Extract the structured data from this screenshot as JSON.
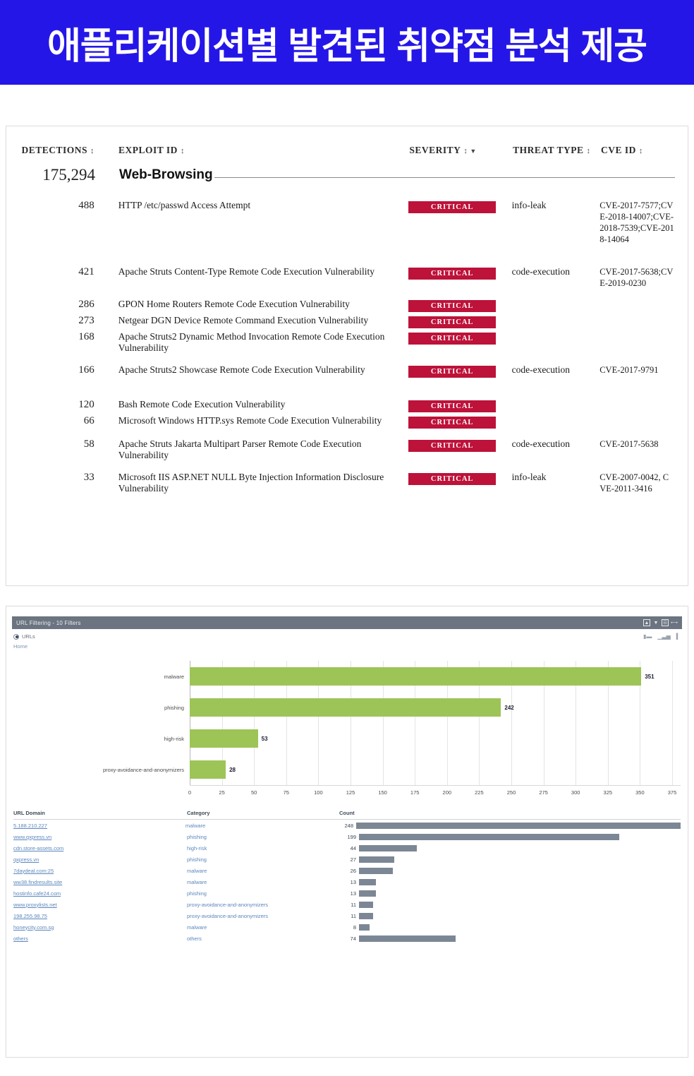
{
  "banner": {
    "title": "애플리케이션별 발견된 취약점 분석 제공",
    "color": "#2516e8"
  },
  "exploit_table": {
    "columns": [
      {
        "label": "DETECTIONS",
        "sort": "↕"
      },
      {
        "label": "EXPLOIT ID",
        "sort": "↕"
      },
      {
        "label": "SEVERITY",
        "sort": "↕",
        "sort_dir": "▼"
      },
      {
        "label": "THREAT TYPE",
        "sort": "↕"
      },
      {
        "label": "CVE ID",
        "sort": "↕"
      }
    ],
    "group": {
      "count": "175,294",
      "name": "Web-Browsing"
    },
    "rows": [
      {
        "detections": "488",
        "exploit_id": "HTTP /etc/passwd Access Attempt",
        "severity": "CRITICAL",
        "threat_type": "info-leak",
        "cve_id": "CVE-2017-7577;CVE-2018-14007;CVE-2018-7539;CVE-2018-14064"
      },
      {
        "detections": "421",
        "exploit_id": "Apache Struts Content-Type Remote Code Execution Vulnerability",
        "severity": "CRITICAL",
        "threat_type": "code-execution",
        "cve_id": "CVE-2017-5638;CVE-2019-0230"
      },
      {
        "detections": "286",
        "exploit_id": "GPON Home Routers Remote Code Execution Vulnerability",
        "severity": "CRITICAL",
        "threat_type": "",
        "cve_id": ""
      },
      {
        "detections": "273",
        "exploit_id": "Netgear DGN Device Remote Command Execution Vulnerability",
        "severity": "CRITICAL",
        "threat_type": "",
        "cve_id": ""
      },
      {
        "detections": "168",
        "exploit_id": "Apache Struts2 Dynamic Method Invocation Remote Code Execution Vulnerability",
        "severity": "CRITICAL",
        "threat_type": "",
        "cve_id": ""
      },
      {
        "detections": "166",
        "exploit_id": "Apache Struts2 Showcase Remote Code Execution Vulnerability",
        "severity": "CRITICAL",
        "threat_type": "code-execution",
        "cve_id": "CVE-2017-9791"
      },
      {
        "detections": "120",
        "exploit_id": "Bash Remote Code Execution Vulnerability",
        "severity": "CRITICAL",
        "threat_type": "",
        "cve_id": ""
      },
      {
        "detections": "66",
        "exploit_id": "Microsoft Windows HTTP.sys Remote Code Execution Vulnerability",
        "severity": "CRITICAL",
        "threat_type": "",
        "cve_id": ""
      },
      {
        "detections": "58",
        "exploit_id": "Apache Struts Jakarta Multipart Parser Remote Code Execution Vulnerability",
        "severity": "CRITICAL",
        "threat_type": "code-execution",
        "cve_id": "CVE-2017-5638"
      },
      {
        "detections": "33",
        "exploit_id": "Microsoft IIS ASP.NET NULL Byte Injection Information Disclosure Vulnerability",
        "severity": "CRITICAL",
        "threat_type": "info-leak",
        "cve_id": "CVE-2007-0042, CVE-2011-3416"
      }
    ],
    "badge_color": "#bd1239"
  },
  "url_panel": {
    "title": "URL Filtering  - 10 Filters",
    "titlebar_icons": [
      "image-icon",
      "filter-icon",
      "list-icon",
      "expand-icon"
    ],
    "subbar_icons": [
      "sort-icon",
      "bar-chart-icon",
      "column-chart-icon"
    ],
    "radio_label": "URLs",
    "breadcrumb": "Home"
  },
  "chart_data": {
    "type": "bar",
    "orientation": "horizontal",
    "title": "",
    "xlabel": "",
    "ylabel": "",
    "categories": [
      "malware",
      "phishing",
      "high-risk",
      "proxy-avoidance-and-anonymizers"
    ],
    "values": [
      351,
      242,
      53,
      28
    ],
    "xlim": [
      0,
      375
    ],
    "xticks": [
      0,
      25,
      50,
      75,
      100,
      125,
      150,
      175,
      200,
      225,
      250,
      275,
      300,
      325,
      350,
      375
    ],
    "grid": true,
    "legend": "none",
    "bar_color": "#9dc457"
  },
  "domain_table": {
    "columns": [
      "URL Domain",
      "Category",
      "Count"
    ],
    "max_count": 248,
    "bar_color": "#7c8795",
    "rows": [
      {
        "domain": "5.188.210.227",
        "category": "malware",
        "count": 248
      },
      {
        "domain": "www.qxpress.vn",
        "category": "phishing",
        "count": 199
      },
      {
        "domain": "cdn.store-assets.com",
        "category": "high-risk",
        "count": 44
      },
      {
        "domain": "qxpress.vn",
        "category": "phishing",
        "count": 27
      },
      {
        "domain": "7daydeal.com:25",
        "category": "malware",
        "count": 26
      },
      {
        "domain": "ww38.findresults.site",
        "category": "malware",
        "count": 13
      },
      {
        "domain": "hostinfo.cafe24.com",
        "category": "phishing",
        "count": 13
      },
      {
        "domain": "www.proxylists.net",
        "category": "proxy-avoidance-and-anonymizers",
        "count": 11
      },
      {
        "domain": "198.255.98.75",
        "category": "proxy-avoidance-and-anonymizers",
        "count": 11
      },
      {
        "domain": "honeycity.com.sg",
        "category": "malware",
        "count": 8
      },
      {
        "domain": "others",
        "category": "others",
        "count": 74
      }
    ]
  }
}
